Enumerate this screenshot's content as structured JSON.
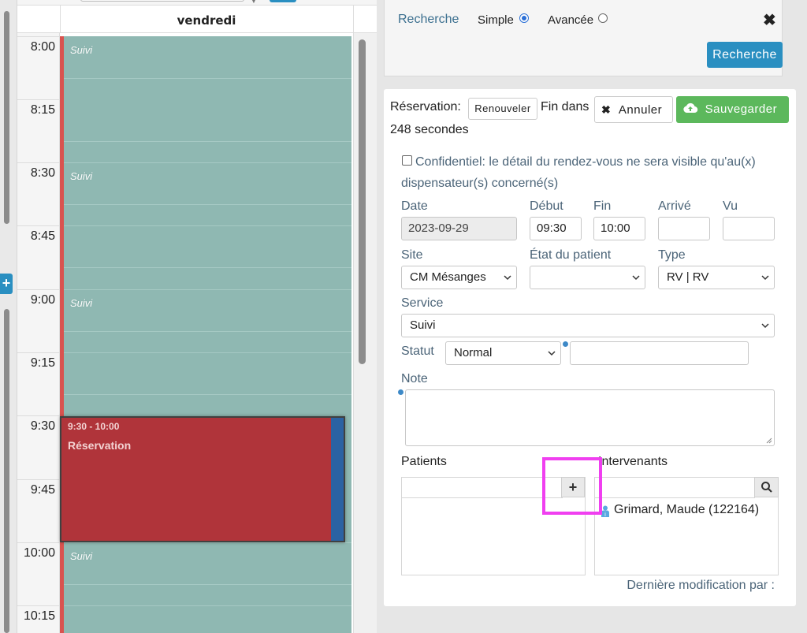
{
  "calendar": {
    "day_title": "vendredi",
    "time_slots": [
      "8:00",
      "8:15",
      "8:30",
      "8:45",
      "9:00",
      "9:15",
      "9:30",
      "9:45",
      "10:00",
      "10:15"
    ],
    "suivi_label": "Suivi",
    "event": {
      "time": "9:30 - 10:00",
      "title": "Réservation"
    },
    "add_icon": "plus-icon"
  },
  "search": {
    "title": "Recherche",
    "simple_label": "Simple",
    "advanced_label": "Avancée",
    "mode_selected": "Simple",
    "close_icon": "close-icon",
    "button_label": "Recherche"
  },
  "form": {
    "reservation_label": "Réservation:",
    "renew_button": "Renouveler",
    "fin_dans": "Fin dans",
    "countdown": "248 secondes",
    "cancel_button": "Annuler",
    "save_button": "Sauvegarder",
    "confidential_text": "Confidentiel: le détail du rendez-vous ne sera visible qu'au(x) dispensateur(s) concerné(s)",
    "confidential_checked": false,
    "labels": {
      "date": "Date",
      "debut": "Début",
      "fin": "Fin",
      "arrive": "Arrivé",
      "vu": "Vu",
      "site": "Site",
      "etat": "État du patient",
      "type": "Type",
      "service": "Service",
      "statut": "Statut",
      "note": "Note",
      "patients": "Patients",
      "intervenants": "Intervenants"
    },
    "values": {
      "date": "2023-09-29",
      "debut": "09:30",
      "fin": "10:00",
      "arrive": "",
      "vu": "",
      "site": "CM Mésanges",
      "etat": "",
      "type": "RV | RV",
      "service": "Suivi",
      "statut": "Normal",
      "statut_extra": "",
      "note": ""
    },
    "intervenant": "Grimard, Maude (122164)",
    "last_modified": "Dernière modification par :",
    "colors": {
      "accent": "#2a8fc1",
      "save": "#5cb85c",
      "event": "#b0343a",
      "suivi": "#8fb8b2",
      "highlight": "#f03ff0"
    }
  }
}
